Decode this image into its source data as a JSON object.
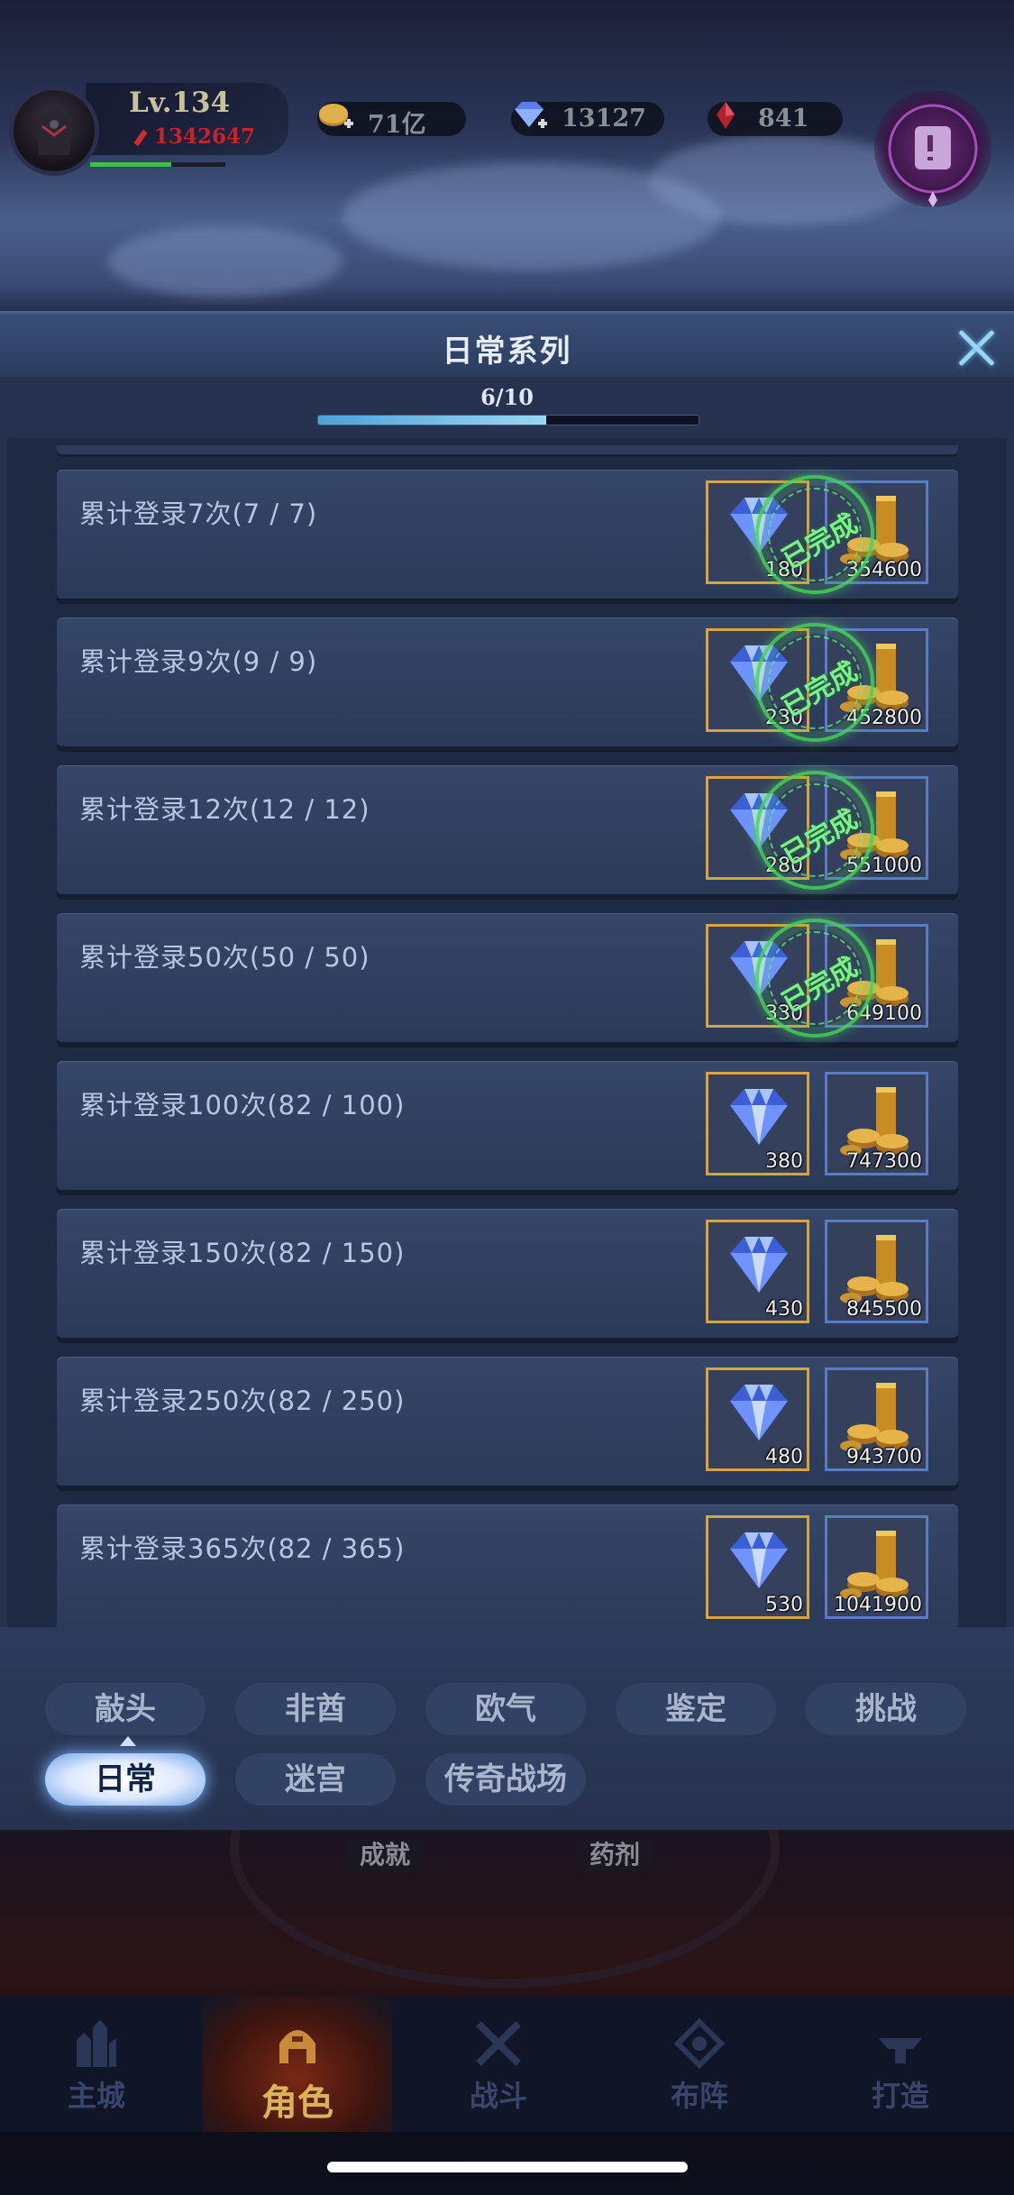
{
  "hud": {
    "level": "Lv.134",
    "power": "1342647",
    "exp_progress": 0.6,
    "resources": [
      {
        "name": "gold",
        "icon": "gold-coin-plus-icon",
        "value": "71亿"
      },
      {
        "name": "diamond",
        "icon": "diamond-plus-icon",
        "value": "13127"
      },
      {
        "name": "ruby",
        "icon": "red-gem-icon",
        "value": "841"
      }
    ]
  },
  "dialog": {
    "title": "日常系列",
    "progress_text": "6/10",
    "progress_value": 0.6,
    "stamp_text": "已完成",
    "tasks": [
      {
        "label": "累计登录7次(7 / 7)",
        "gem": "180",
        "gold": "354600",
        "completed": true
      },
      {
        "label": "累计登录9次(9 / 9)",
        "gem": "230",
        "gold": "452800",
        "completed": true
      },
      {
        "label": "累计登录12次(12 / 12)",
        "gem": "280",
        "gold": "551000",
        "completed": true
      },
      {
        "label": "累计登录50次(50 / 50)",
        "gem": "330",
        "gold": "649100",
        "completed": true
      },
      {
        "label": "累计登录100次(82 / 100)",
        "gem": "380",
        "gold": "747300",
        "completed": false
      },
      {
        "label": "累计登录150次(82 / 150)",
        "gem": "430",
        "gold": "845500",
        "completed": false
      },
      {
        "label": "累计登录250次(82 / 250)",
        "gem": "480",
        "gold": "943700",
        "completed": false
      },
      {
        "label": "累计登录365次(82 / 365)",
        "gem": "530",
        "gold": "1041900",
        "completed": false
      }
    ]
  },
  "tabs": {
    "row1": [
      "敲头",
      "非酋",
      "欧气",
      "鉴定",
      "挑战"
    ],
    "row2": [
      "日常",
      "迷宫",
      "传奇战场"
    ],
    "active": "日常"
  },
  "lower": {
    "labels": [
      "成就",
      "药剂"
    ]
  },
  "nav": {
    "items": [
      {
        "label": "主城",
        "icon": "city-icon"
      },
      {
        "label": "角色",
        "icon": "helmet-icon"
      },
      {
        "label": "战斗",
        "icon": "crossed-swords-icon"
      },
      {
        "label": "布阵",
        "icon": "formation-icon"
      },
      {
        "label": "打造",
        "icon": "anvil-icon"
      }
    ],
    "active": "角色"
  },
  "colors": {
    "accent": "#4aa3d8",
    "gem_border": "#d9a43b",
    "gold_border": "#5a7cc4",
    "completed_stamp": "#46d25a",
    "power": "#c7232b"
  }
}
